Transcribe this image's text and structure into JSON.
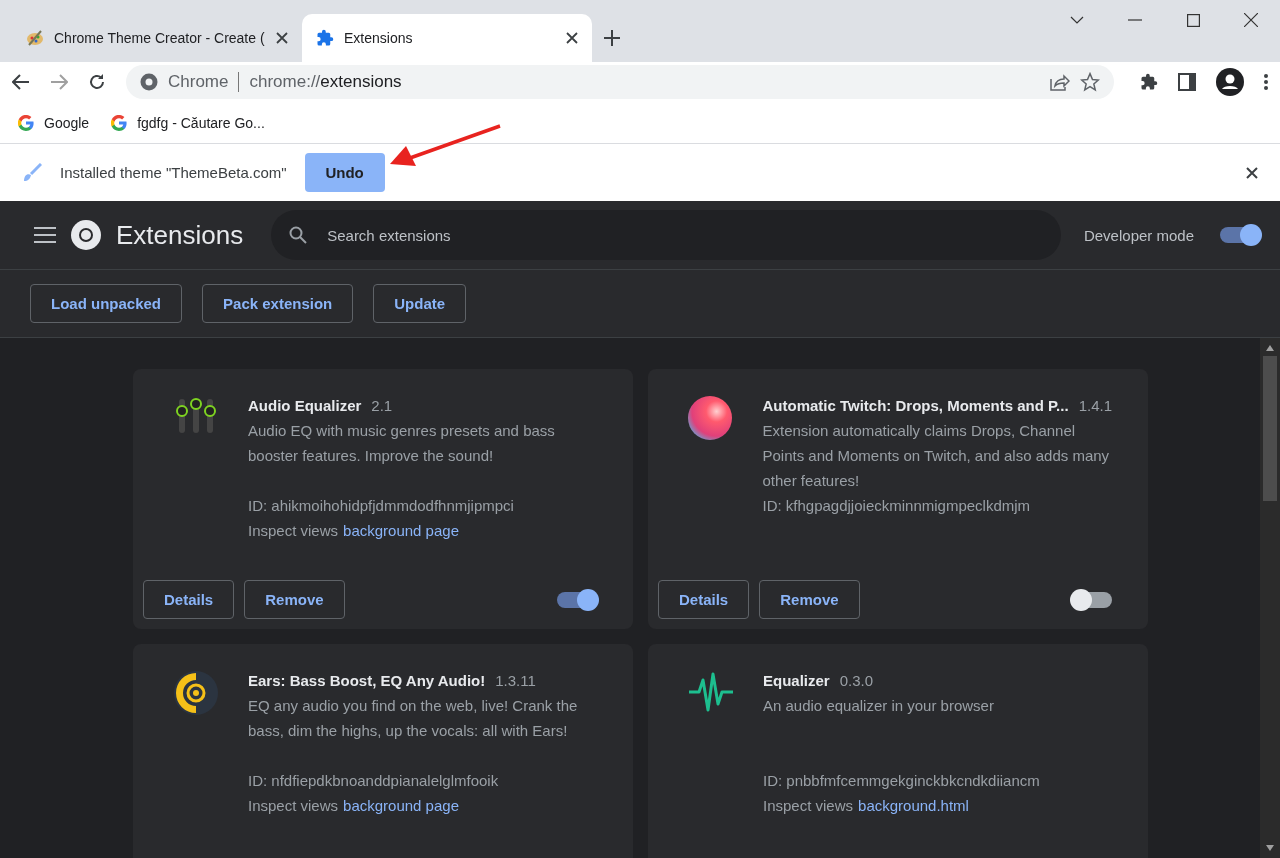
{
  "tabs": [
    {
      "title": "Chrome Theme Creator - Create (",
      "selected": false
    },
    {
      "title": "Extensions",
      "selected": true
    }
  ],
  "address": {
    "origin": "Chrome",
    "prefix": "chrome://",
    "path": "extensions"
  },
  "bookmarks": [
    "Google",
    "fgdfg - Căutare Go..."
  ],
  "infobar": {
    "message": "Installed theme \"ThemeBeta.com\"",
    "button": "Undo"
  },
  "header": {
    "title": "Extensions",
    "search_placeholder": "Search extensions",
    "developer_mode_label": "Developer mode",
    "developer_mode": true
  },
  "toolbar_buttons": [
    "Load unpacked",
    "Pack extension",
    "Update"
  ],
  "extensions": [
    {
      "name": "Audio Equalizer",
      "version": "2.1",
      "description": "Audio EQ with music genres presets and bass booster features. Improve the sound!",
      "id": "ID: ahikmoihohidpfjdmmdodfhnmjipmpci",
      "inspect_label": "Inspect views",
      "inspect_link": "background page",
      "buttons": [
        "Details",
        "Remove"
      ],
      "enabled": true
    },
    {
      "name": "Automatic Twitch: Drops, Moments and P...",
      "version": "1.4.1",
      "description": "Extension automatically claims Drops, Channel Points and Moments on Twitch, and also adds many other features!",
      "id": "ID: kfhgpagdjjoieckminnmigmpeclkdmjm",
      "buttons": [
        "Details",
        "Remove"
      ],
      "enabled": false
    },
    {
      "name": "Ears: Bass Boost, EQ Any Audio!",
      "version": "1.3.11",
      "description": "EQ any audio you find on the web, live! Crank the bass, dim the highs, up the vocals: all with Ears!",
      "id": "ID: nfdfiepdkbnoanddpianalelglmfooik",
      "inspect_label": "Inspect views",
      "inspect_link": "background page"
    },
    {
      "name": "Equalizer",
      "version": "0.3.0",
      "description": "An audio equalizer in your browser",
      "id": "ID: pnbbfmfcemmgekginckbkcndkdiiancm",
      "inspect_label": "Inspect views",
      "inspect_link": "background.html"
    }
  ]
}
